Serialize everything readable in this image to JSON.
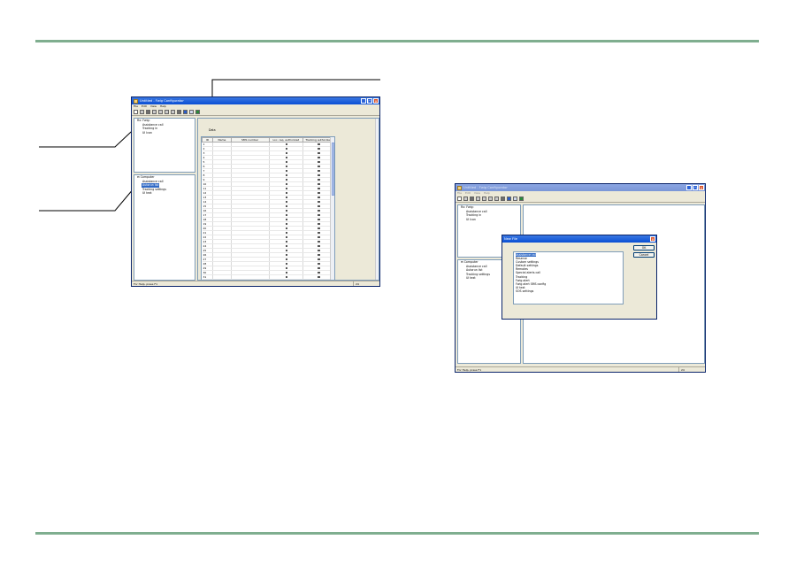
{
  "app": {
    "title": "Untitled - Fwig Configurator",
    "menus": [
      "File",
      "Edit",
      "View",
      "Help"
    ],
    "min_glyph": "_",
    "max_glyph": "□",
    "close_glyph": "✕",
    "toolbar_icons": [
      "new-icon",
      "open-icon",
      "save-icon",
      "cut-icon",
      "copy-icon",
      "paste-icon",
      "print-icon",
      "help-icon",
      "download-icon",
      "upload-icon",
      "refresh-icon"
    ]
  },
  "tree_top": [
    "Rx: Fwig:",
    "Assistance call",
    "Tracking in",
    "UI Icon"
  ],
  "tree_bottom": {
    "expand_glyph": "⊟",
    "root": "Computer",
    "children": [
      "Assistance call",
      "Autorun list",
      "Tracking settings",
      "UI text"
    ],
    "selected_index": 1
  },
  "grid": {
    "caption": "Data",
    "columns": [
      "ID",
      "Name",
      "SMS number",
      "Loc. req. authorized",
      "Tracking authorized"
    ],
    "row_ids": [
      "1",
      "2",
      "3",
      "4",
      "5",
      "6",
      "7",
      "8",
      "9",
      "10",
      "11",
      "12",
      "13",
      "14",
      "15",
      "16",
      "17",
      "18",
      "19",
      "20",
      "21",
      "22",
      "23",
      "24",
      "25",
      "26",
      "27",
      "28",
      "29",
      "30",
      "31",
      "32",
      "33",
      "34",
      "35",
      "36",
      "37",
      "38"
    ]
  },
  "status": {
    "text": "For Help, press F1",
    "indicator": "24"
  },
  "dialog": {
    "title": "New File",
    "items": [
      "Assistance call",
      "Reserve",
      "Custom settings",
      "Default settings",
      "Remotes",
      "Special alerts call",
      "Tracking",
      "Fwig alert",
      "Fwig alert SMS config",
      "UI text",
      "SOS settings"
    ],
    "selected_index": 0,
    "ok": "OK",
    "cancel": "Cancel"
  },
  "colors": {
    "rule": "#7fae8f",
    "titlebar": "#0a4fd4",
    "selection": "#316ac5"
  }
}
